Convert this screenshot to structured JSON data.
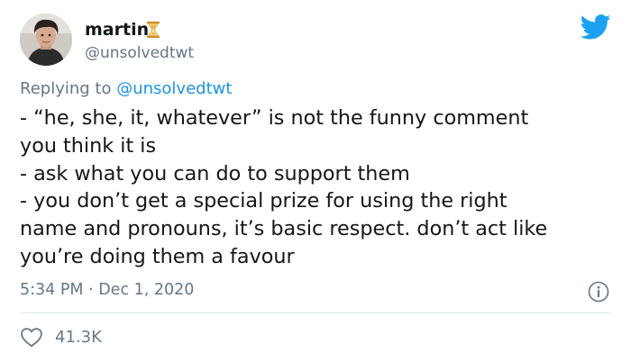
{
  "author": {
    "display_name": "martin",
    "handle": "@unsolvedtwt"
  },
  "reply": {
    "prefix": "Replying to ",
    "handle": "@unsolvedtwt"
  },
  "body_lines": [
    "- “he, she, it, whatever” is not the funny comment",
    "you think it is",
    "- ask what you can do to support them",
    "- you don’t get a special prize for using the right",
    "name and pronouns, it’s basic respect. don’t act like",
    "you’re doing them a favour"
  ],
  "timestamp": "5:34 PM · Dec 1, 2020",
  "likes": "41.3K",
  "icons": {
    "brand": "twitter-bird-icon",
    "status": "hourglass-icon",
    "info": "info-icon",
    "like": "heart-icon"
  },
  "colors": {
    "brand": "#1da1f2",
    "link": "#1b95e0",
    "secondary_text": "#657786",
    "hourglass": "#e6b23a"
  }
}
